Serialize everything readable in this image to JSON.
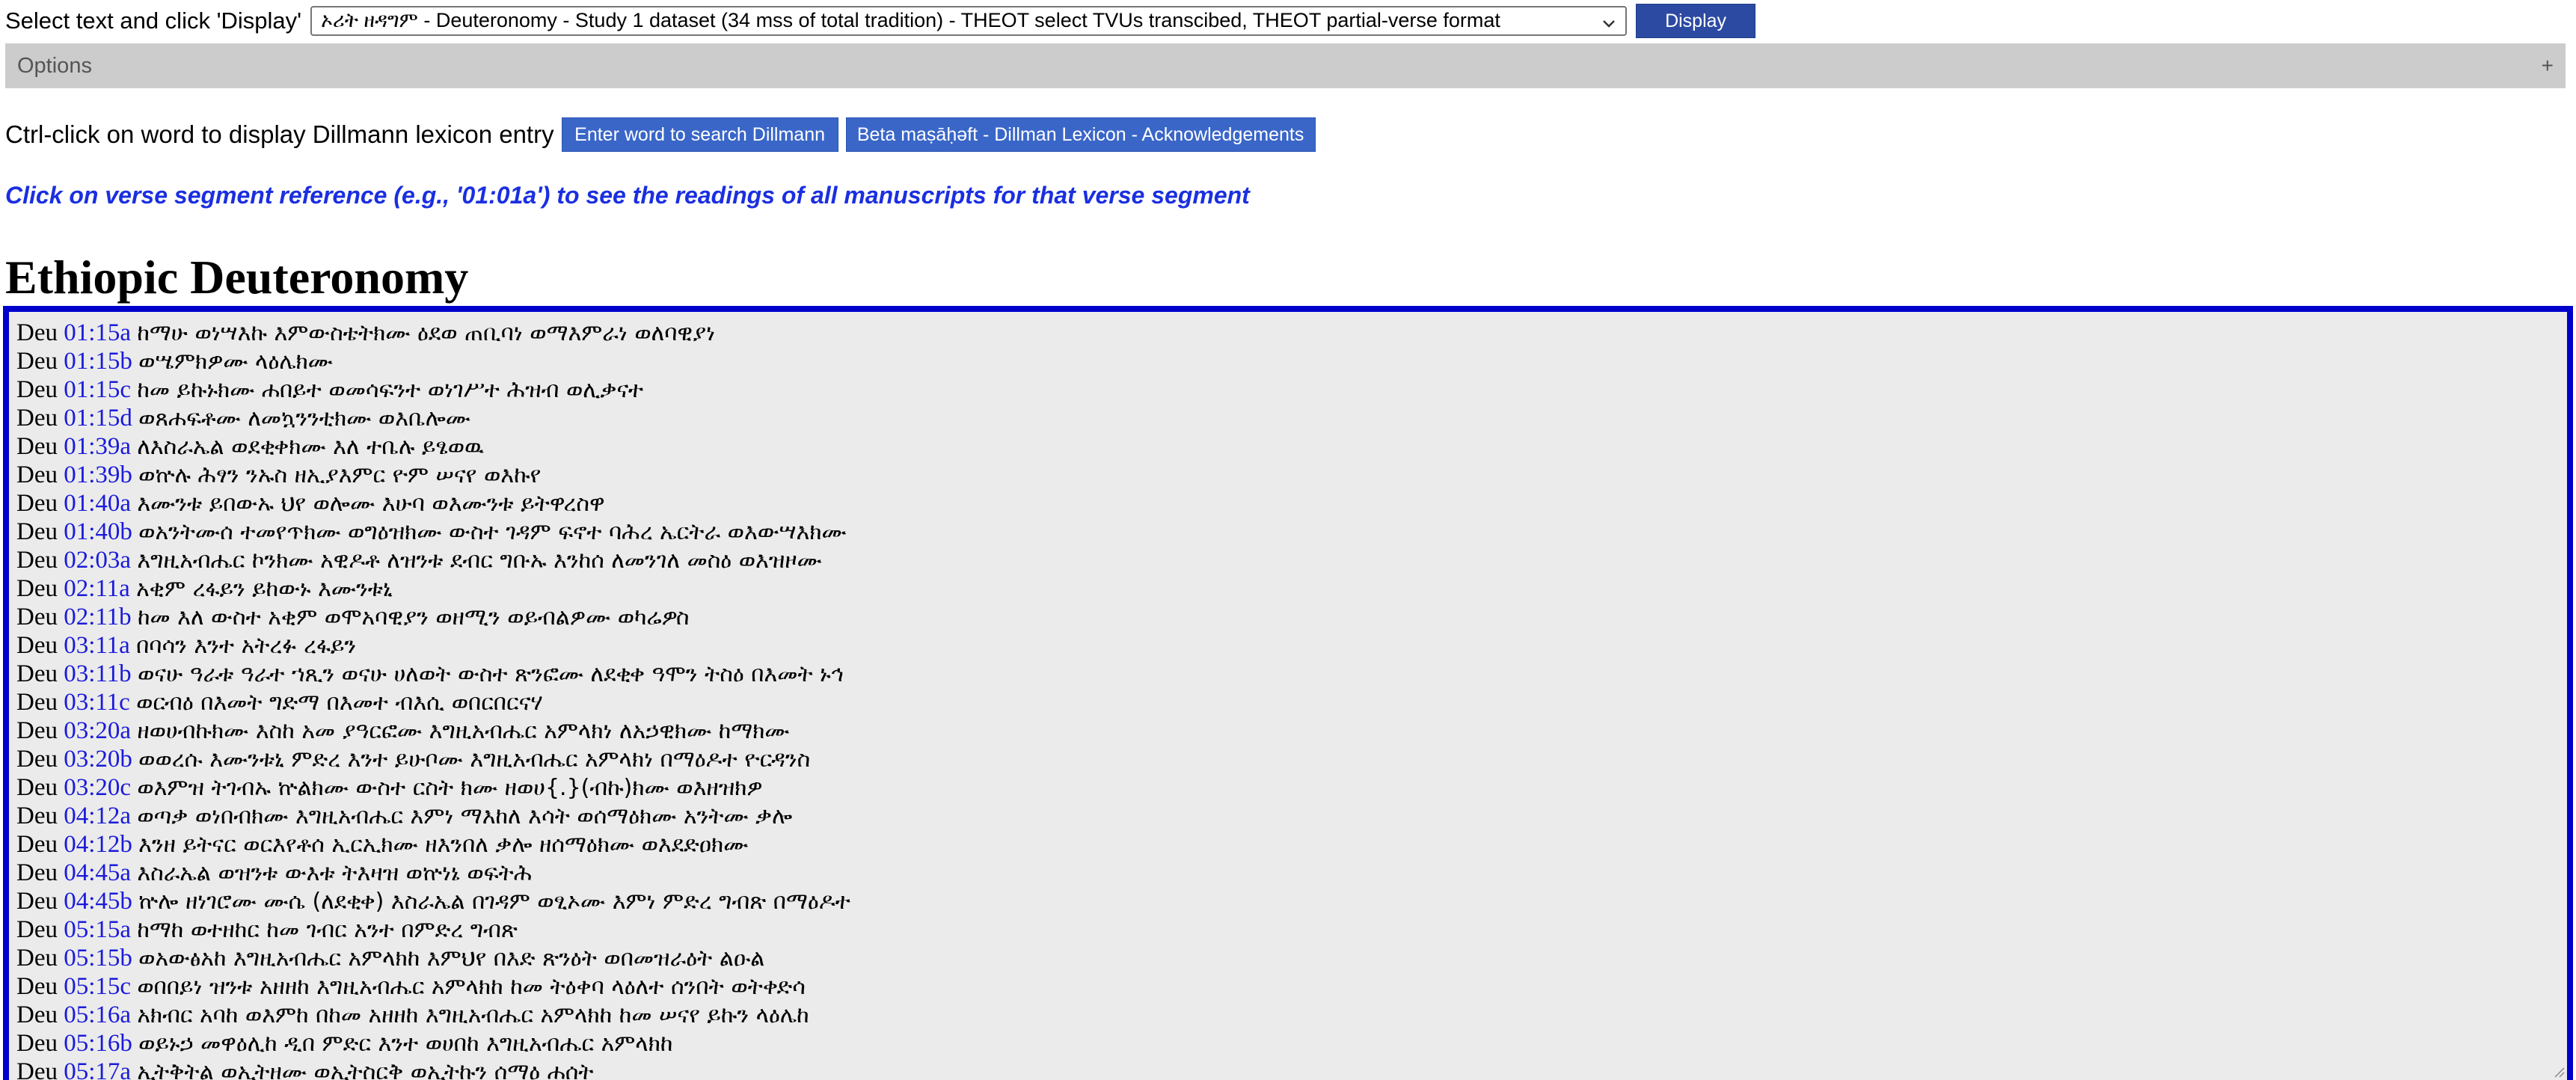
{
  "top_bar": {
    "label": "Select text and click 'Display'",
    "selected_text": "ኦሪት ዘዳግም - Deuteronomy - Study 1 dataset (34 mss of total tradition) - THEOT select TVUs transcibed, THEOT partial-verse format",
    "display_button": "Display"
  },
  "options": {
    "label": "Options",
    "toggle": "+"
  },
  "lexicon": {
    "label": "Ctrl-click on word to display Dillmann lexicon entry",
    "search_button": "Enter word to search Dillmann",
    "ack_button": "Beta maṣāḥǝft - Dillman Lexicon - Acknowledgements"
  },
  "instruction": "Click on verse segment reference (e.g., '01:01a') to see the readings of all manuscripts for that verse segment",
  "title": "Ethiopic Deuteronomy",
  "verses": [
    {
      "book": "Deu",
      "ref": "01:15a",
      "text": "ከማሁ ወነሣእኩ እምውስቴትክሙ ዕደወ ጠቢባነ ወማእምራነ ወለባዊያነ"
    },
    {
      "book": "Deu",
      "ref": "01:15b",
      "text": "ወሤምክዎሙ ላዕሌክሙ"
    },
    {
      "book": "Deu",
      "ref": "01:15c",
      "text": "ከመ ይኩኑክሙ ሐበይተ ወመሳፍንተ ወነገሥተ ሕዝብ ወሊቃናተ"
    },
    {
      "book": "Deu",
      "ref": "01:15d",
      "text": "ወጸሐፍቶሙ ለመኳንንቲክሙ ወእቤሎሙ"
    },
    {
      "book": "Deu",
      "ref": "01:39a",
      "text": "ለእስራኤል ወደቂቀክሙ እለ ተቤሉ ይፄወዉ"
    },
    {
      "book": "Deu",
      "ref": "01:39b",
      "text": "ወኵሉ ሕፃን ንኡስ ዘኢያእምር ዮም ሠናየ ወእኩየ"
    },
    {
      "book": "Deu",
      "ref": "01:40a",
      "text": "እሙንቱ ይበውኡ ህየ ወሎሙ እሁባ ወእሙንቱ ይትዋረስዋ"
    },
    {
      "book": "Deu",
      "ref": "01:40b",
      "text": "ወአንትሙሰ ተመየጥክሙ ወግዕዝክሙ ውስተ ገዳም ፍኖተ ባሕረ ኤርትራ ወእውሣእክሙ"
    },
    {
      "book": "Deu",
      "ref": "02:03a",
      "text": "እግዚአብሔር ኮንክሙ አዊዶቶ ለዝንቱ ደብር ግቡኡ እንከሰ ለመንገለ መስዕ ወእዝዞሙ"
    },
    {
      "book": "Deu",
      "ref": "02:11a",
      "text": "አቂም ረፋይን ይከውኑ እሙንቱኒ"
    },
    {
      "book": "Deu",
      "ref": "02:11b",
      "text": "ከመ እለ ውስተ አቂም ወሞአባዊያን ወዘሚን ወይብልዎሙ ወካሬዎስ"
    },
    {
      "book": "Deu",
      "ref": "03:11a",
      "text": "በባሳን እንተ አትረፉ ረፋይን"
    },
    {
      "book": "Deu",
      "ref": "03:11b",
      "text": "ወናሁ ዓራቱ ዓራተ ኀጺን ወናሁ ሀለወት ውስተ ጽንፎሙ ለደቂቀ ዓሞን ትስዕ በእመት ኑኅ"
    },
    {
      "book": "Deu",
      "ref": "03:11c",
      "text": "ወርብዕ በእመት ግድማ በእመተ ብእሲ ወበርበርናሃ"
    },
    {
      "book": "Deu",
      "ref": "03:20a",
      "text": "ዘወሀብኩክሙ እስከ አመ ያዓርፎሙ እግዚአብሔር አምላክነ ለአኃዊክሙ ከማክሙ"
    },
    {
      "book": "Deu",
      "ref": "03:20b",
      "text": "ወወረሱ እሙንቱኒ ምድረ እንተ ይሁቦሙ እግዚአብሔር አምላክነ በማዕዶተ ዮርዳንስ"
    },
    {
      "book": "Deu",
      "ref": "03:20c",
      "text": "ወእምዝ ትገብኡ ኵልክሙ ውስተ ርስት ክሙ ዘወሀ{.}(ብኩ)ክሙ ወእዘዝክዎ"
    },
    {
      "book": "Deu",
      "ref": "04:12a",
      "text": "ወጣቃ ወነበብክሙ እግዚአብሔር እምነ ማእከለ እሳት ወሰማዕክሙ አንትሙ ቃሎ"
    },
    {
      "book": "Deu",
      "ref": "04:12b",
      "text": "እንዘ ይትናር ወርእየቶሰ ኢርኢክሙ ዘእንበለ ቃሎ ዘሰማዕክሙ ወእደድዐክሙ"
    },
    {
      "book": "Deu",
      "ref": "04:45a",
      "text": "እስራኤል ወዝንቱ ውእቱ ትእዛዝ ወኵነኔ ወፍትሕ"
    },
    {
      "book": "Deu",
      "ref": "04:45b",
      "text": "ኵሎ ዘነገሮሙ ሙሴ (ለደቂቀ) እስራኤል በገዳም ወፂኦሙ እምነ ምድረ ግብጽ በማዕዶተ"
    },
    {
      "book": "Deu",
      "ref": "05:15a",
      "text": "ከማከ ወተዘከር ከመ ገብር አንተ በምድረ ግብጽ"
    },
    {
      "book": "Deu",
      "ref": "05:15b",
      "text": "ወአውፅአከ እግዚአብሔር አምላክከ እምህየ በእድ ጽንዕት ወበመዝራዕት ልዑል"
    },
    {
      "book": "Deu",
      "ref": "05:15c",
      "text": "ወበበይነ ዝንቱ አዘዘከ እግዚአብሔር አምላክከ ከመ ትዕቀባ ላዕለተ ሰንበት ወትቀድሳ"
    },
    {
      "book": "Deu",
      "ref": "05:16a",
      "text": "አክብር አባከ ወእምከ በከመ አዘዘከ እግዚአብሔር አምላክከ ከመ ሠናየ ይኩን ላዕሌከ"
    },
    {
      "book": "Deu",
      "ref": "05:16b",
      "text": "ወይኑኃ መዋዕሊከ ዲበ ምድር እንተ ወሀበከ እግዚአብሔር አምላክከ"
    },
    {
      "book": "Deu",
      "ref": "05:17a",
      "text": "ኢትቅትል ወኢትዘሙ ወኢትስርቅ ወኢትኩን ሰማዕ ሐሰት"
    }
  ]
}
